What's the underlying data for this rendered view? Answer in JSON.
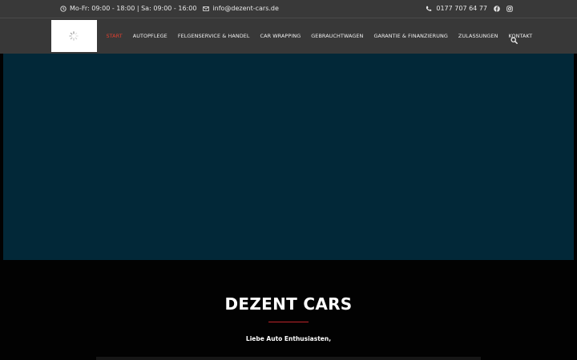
{
  "topbar": {
    "hours": "Mo-Fr: 09:00 - 18:00 | Sa: 09:00 - 16:00",
    "email": "info@dezent-cars.de",
    "phone": "0177 707 64 77"
  },
  "nav": {
    "items": [
      {
        "label": "START",
        "active": true
      },
      {
        "label": "AUTOPFLEGE"
      },
      {
        "label": "FELGENSERVICE & HANDEL"
      },
      {
        "label": "CAR WRAPPING"
      },
      {
        "label": "GEBRAUCHTWAGEN"
      },
      {
        "label": "GARANTIE & FINANZIERUNG"
      },
      {
        "label": "ZULASSUNGEN"
      },
      {
        "label": "KONTAKT"
      }
    ]
  },
  "main": {
    "title": "DEZENT CARS",
    "greeting": "Liebe Auto Enthusiasten,"
  },
  "colors": {
    "accent": "#e0402f",
    "hero": "#022838",
    "topbar": "#393939",
    "navbar": "#383838"
  },
  "icons": [
    "clock-icon",
    "mail-icon",
    "phone-icon",
    "facebook-icon",
    "instagram-icon",
    "search-icon",
    "loading-spinner-icon"
  ]
}
